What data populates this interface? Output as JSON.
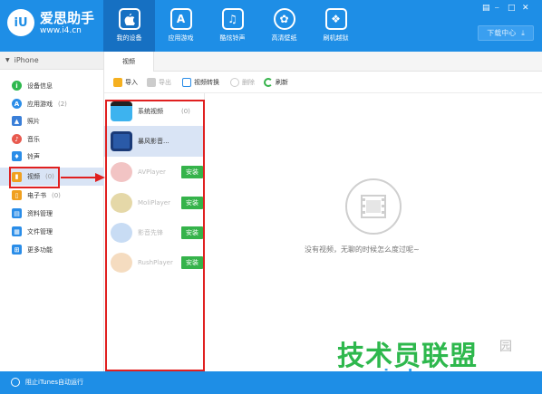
{
  "brand": {
    "name": "爱思助手",
    "url": "www.i4.cn",
    "logo_text": "iU"
  },
  "nav": [
    {
      "label": "我的设备",
      "icon": "apple-icon"
    },
    {
      "label": "应用游戏",
      "icon": "appstore-icon"
    },
    {
      "label": "酷炫铃声",
      "icon": "music-note-icon"
    },
    {
      "label": "高清壁纸",
      "icon": "flower-icon"
    },
    {
      "label": "刷机越狱",
      "icon": "dropbox-icon"
    }
  ],
  "download_center": "下载中心",
  "device": "iPhone",
  "sidebar": [
    {
      "label": "设备信息",
      "icon": "info-icon",
      "color": "#2db84d"
    },
    {
      "label": "应用游戏",
      "count": "(2)",
      "icon": "apps-icon",
      "color": "#2a8de8"
    },
    {
      "label": "照片",
      "icon": "photo-icon",
      "color": "#3a7fd8"
    },
    {
      "label": "音乐",
      "icon": "music-icon",
      "color": "#e85a4f"
    },
    {
      "label": "铃声",
      "icon": "bell-icon",
      "color": "#2a8de8"
    },
    {
      "label": "视频",
      "count": "(0)",
      "icon": "video-icon",
      "color": "#f0a020"
    },
    {
      "label": "电子书",
      "count": "(0)",
      "icon": "book-icon",
      "color": "#f0a020"
    },
    {
      "label": "资料管理",
      "icon": "contacts-icon",
      "color": "#2a8de8"
    },
    {
      "label": "文件管理",
      "icon": "file-icon",
      "color": "#2a8de8"
    },
    {
      "label": "更多功能",
      "icon": "grid-icon",
      "color": "#2a8de8"
    }
  ],
  "subtab": "视频",
  "toolbar": [
    {
      "label": "导入",
      "enabled": true
    },
    {
      "label": "导出",
      "enabled": false
    },
    {
      "label": "视频转换",
      "enabled": true
    },
    {
      "label": "删除",
      "enabled": false
    },
    {
      "label": "刷新",
      "enabled": true
    }
  ],
  "apps": [
    {
      "name": "系统视频",
      "count": "(0)",
      "color": "#3db3ef"
    },
    {
      "name": "暴风影音...",
      "count": "",
      "color": "#2a5aa8"
    },
    {
      "name": "AVPlayer",
      "install": "安装",
      "color": "#f2c4c4"
    },
    {
      "name": "MoliPlayer",
      "install": "安装",
      "color": "#e5d8a8"
    },
    {
      "name": "影音先锋",
      "install": "安装",
      "color": "#c8dcf4"
    },
    {
      "name": "RushPlayer",
      "install": "安装",
      "color": "#f5dcc0"
    }
  ],
  "empty_message": "没有视频，无聊的时候怎么度过呢~",
  "itunes_toggle": "阻止iTunes自动运行",
  "watermark": {
    "main": "技术员联盟",
    "sub": "www.jsgho.com",
    "side": "园"
  }
}
